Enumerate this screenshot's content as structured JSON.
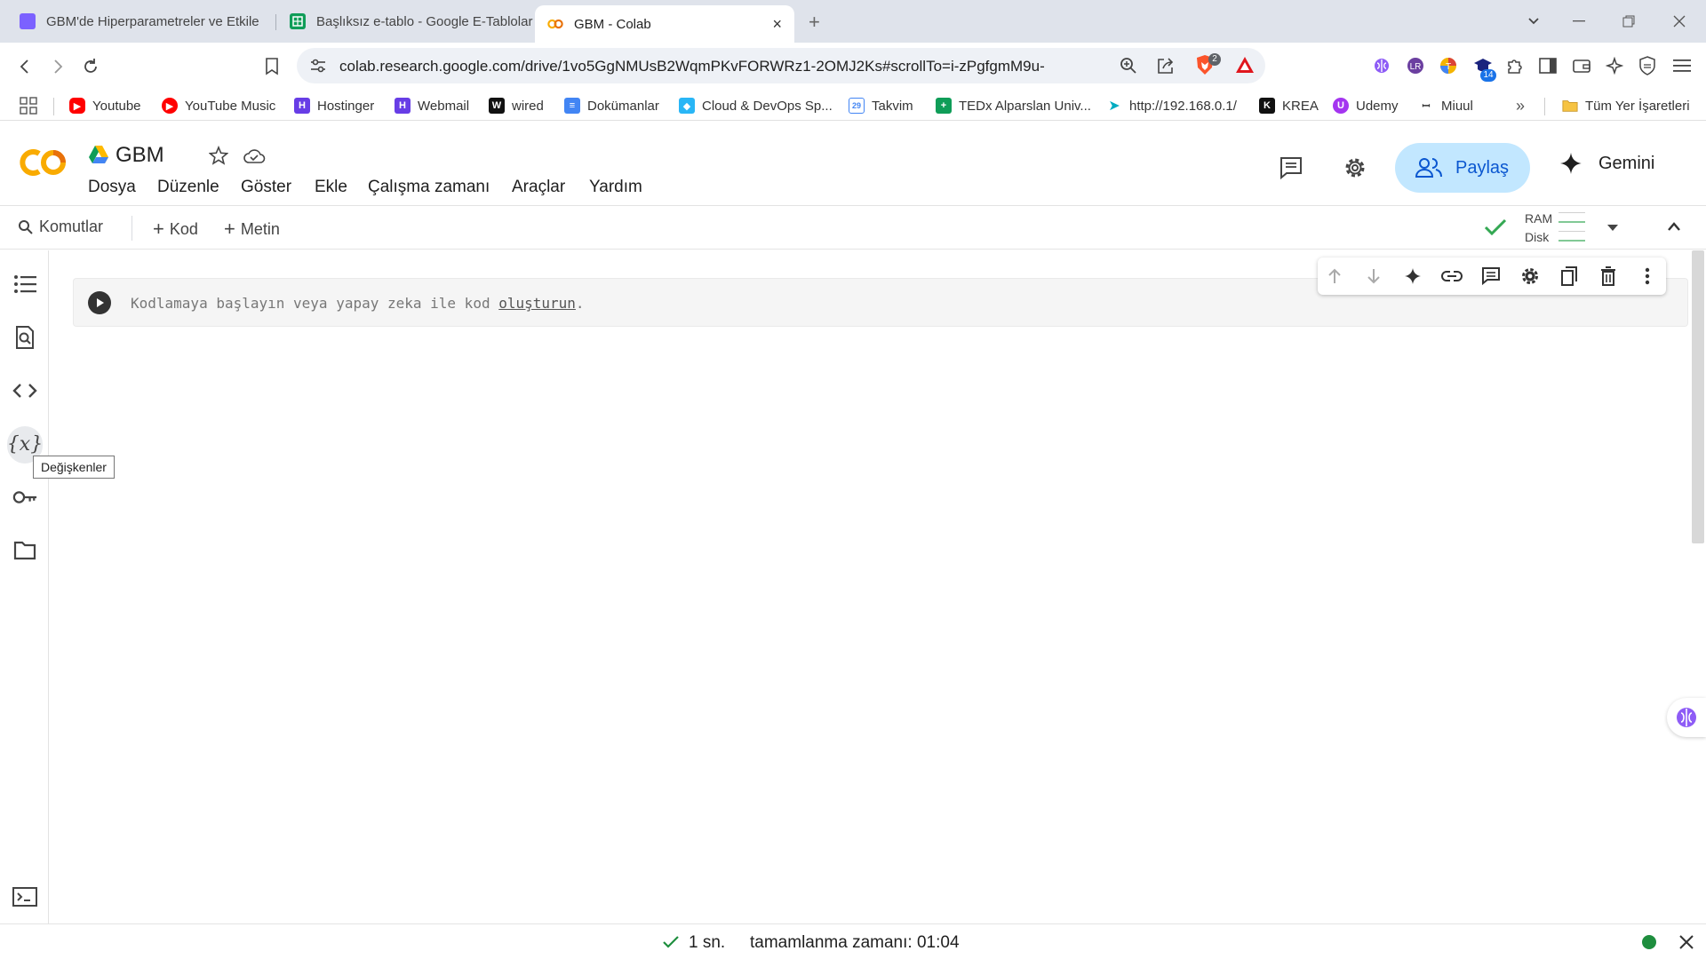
{
  "browser": {
    "tabs": [
      {
        "title": "GBM'de Hiperparametreler ve Etkile",
        "active": false
      },
      {
        "title": "Başlıksız e-tablo - Google E-Tablolar",
        "active": false
      },
      {
        "title": "GBM - Colab",
        "active": true
      }
    ],
    "url": "colab.research.google.com/drive/1vo5GgNMUsB2WqmPKvFORWRz1-2OMJ2Ks#scrollTo=i-zPgfgmM9u-",
    "extensions": {
      "brave_badge": "2",
      "ext_badge": "14"
    },
    "bookmarks": [
      "Youtube",
      "YouTube Music",
      "Hostinger",
      "Webmail",
      "wired",
      "Dokümanlar",
      "Cloud & DevOps Sp...",
      "Takvim",
      "TEDx Alparslan Univ...",
      "http://192.168.0.1/",
      "KREA",
      "Udemy",
      "Miuul"
    ],
    "bookmarks_overflow": "»",
    "all_bookmarks": "Tüm Yer İşaretleri"
  },
  "colab": {
    "logo_text": "CO",
    "notebook_name": "GBM",
    "menu": [
      "Dosya",
      "Düzenle",
      "Göster",
      "Ekle",
      "Çalışma zamanı",
      "Araçlar",
      "Yardım"
    ],
    "share_label": "Paylaş",
    "gemini_label": "Gemini",
    "toolbar": {
      "commands": "Komutlar",
      "add_code": "Kod",
      "add_text": "Metin",
      "ram": "RAM",
      "disk": "Disk"
    },
    "cell": {
      "placeholder_before": "Kodlamaya başlayın veya yapay zeka ile kod ",
      "placeholder_link": "oluşturun",
      "placeholder_after": "."
    },
    "tooltip": "Değişkenler",
    "status": {
      "duration": "1 sn.",
      "completed": "tamamlanma zamanı: 01:04"
    }
  },
  "colors": {
    "accent": "#0b57d0",
    "share_bg": "#c2e7ff",
    "ok_green": "#34a853",
    "status_dot": "#1e8e3e",
    "logo_orange": "#f9ab00"
  }
}
